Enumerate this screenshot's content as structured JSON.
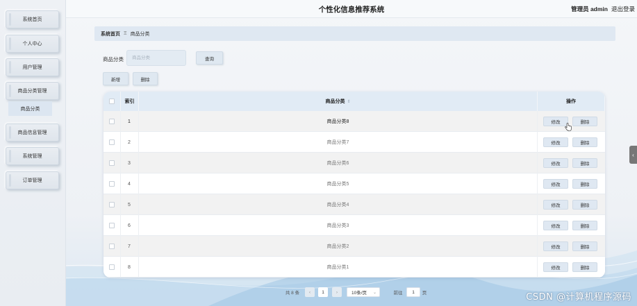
{
  "app": {
    "title": "个性化信息推荐系统",
    "user_label": "管理员 admin",
    "logout_label": "退出登录"
  },
  "sidebar": {
    "items": [
      {
        "label": "系统首页"
      },
      {
        "label": "个人中心"
      },
      {
        "label": "用户管理"
      },
      {
        "label": "商品分类管理"
      },
      {
        "label": "商品信息管理"
      },
      {
        "label": "系统管理"
      },
      {
        "label": "订单管理"
      }
    ],
    "active_sub": "商品分类"
  },
  "breadcrumb": {
    "home": "系统首页",
    "separator": "Ξ",
    "current": "商品分类"
  },
  "search": {
    "label": "商品分类",
    "placeholder": "商品分类",
    "query_label": "查询"
  },
  "toolbar": {
    "add_label": "新增",
    "delete_label": "删除"
  },
  "table": {
    "headers": {
      "index": "索引",
      "name": "商品分类",
      "actions": "操作"
    },
    "sort_glyph": "⇕",
    "edit_label": "修改",
    "delete_label": "删除",
    "rows": [
      {
        "index": "1",
        "name": "商品分类8"
      },
      {
        "index": "2",
        "name": "商品分类7"
      },
      {
        "index": "3",
        "name": "商品分类6"
      },
      {
        "index": "4",
        "name": "商品分类5"
      },
      {
        "index": "5",
        "name": "商品分类4"
      },
      {
        "index": "6",
        "name": "商品分类3"
      },
      {
        "index": "7",
        "name": "商品分类2"
      },
      {
        "index": "8",
        "name": "商品分类1"
      }
    ]
  },
  "pagination": {
    "total_label": "共 8 条",
    "prev": "‹",
    "current_page": "1",
    "next": "›",
    "page_size": "10条/页",
    "goto_label": "前往",
    "goto_value": "1",
    "page_suffix": "页"
  },
  "watermark": "CSDN @计算机程序源码",
  "colors": {
    "accent": "#dfe8f2",
    "header_row": "#e1ebf5",
    "sidebar": "#e9edf2"
  }
}
